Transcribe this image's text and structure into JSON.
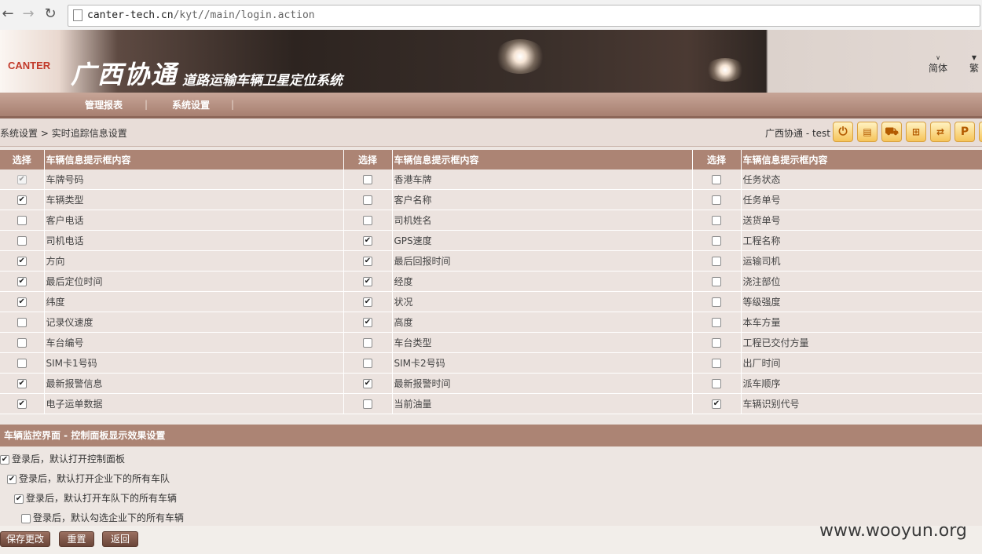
{
  "browser": {
    "url_host": "canter-tech.cn",
    "url_path": "/kyt//main/login.action"
  },
  "header": {
    "logo_text": "CANTER",
    "title": "广西协通",
    "subtitle": "道路运输车辆卫星定位系统",
    "lang_simplified": "简体",
    "lang_traditional": "繁"
  },
  "menu": {
    "items": [
      "管理报表",
      "系统设置"
    ]
  },
  "breadcrumb": {
    "root": "系统设置",
    "separator": ">",
    "current": "实时追踪信息设置"
  },
  "user": {
    "label": "广西协通 - test"
  },
  "table": {
    "col_select": "选择",
    "col_content": "车辆信息提示框内容",
    "rows": [
      [
        {
          "checked": true,
          "disabled": true,
          "label": "车牌号码"
        },
        {
          "checked": false,
          "label": "香港车牌"
        },
        {
          "checked": false,
          "label": "任务状态"
        }
      ],
      [
        {
          "checked": true,
          "label": "车辆类型"
        },
        {
          "checked": false,
          "label": "客户名称"
        },
        {
          "checked": false,
          "label": "任务单号"
        }
      ],
      [
        {
          "checked": false,
          "label": "客户电话"
        },
        {
          "checked": false,
          "label": "司机姓名"
        },
        {
          "checked": false,
          "label": "送货单号"
        }
      ],
      [
        {
          "checked": false,
          "label": "司机电话"
        },
        {
          "checked": true,
          "label": "GPS速度"
        },
        {
          "checked": false,
          "label": "工程名称"
        }
      ],
      [
        {
          "checked": true,
          "label": "方向"
        },
        {
          "checked": true,
          "label": "最后回报时间"
        },
        {
          "checked": false,
          "label": "运输司机"
        }
      ],
      [
        {
          "checked": true,
          "label": "最后定位时间"
        },
        {
          "checked": true,
          "label": "经度"
        },
        {
          "checked": false,
          "label": "浇注部位"
        }
      ],
      [
        {
          "checked": true,
          "label": "纬度"
        },
        {
          "checked": true,
          "label": "状况"
        },
        {
          "checked": false,
          "label": "等级强度"
        }
      ],
      [
        {
          "checked": false,
          "label": "记录仪速度"
        },
        {
          "checked": true,
          "label": "高度"
        },
        {
          "checked": false,
          "label": "本车方量"
        }
      ],
      [
        {
          "checked": false,
          "label": "车台编号"
        },
        {
          "checked": false,
          "label": "车台类型"
        },
        {
          "checked": false,
          "label": "工程已交付方量"
        }
      ],
      [
        {
          "checked": false,
          "label": "SIM卡1号码"
        },
        {
          "checked": false,
          "label": "SIM卡2号码"
        },
        {
          "checked": false,
          "label": "出厂时间"
        }
      ],
      [
        {
          "checked": true,
          "label": "最新报警信息"
        },
        {
          "checked": true,
          "label": "最新报警时间"
        },
        {
          "checked": false,
          "label": "派车顺序"
        }
      ],
      [
        {
          "checked": true,
          "label": "电子运单数据"
        },
        {
          "checked": false,
          "label": "当前油量"
        },
        {
          "checked": true,
          "label": "车辆识别代号"
        }
      ]
    ]
  },
  "panel": {
    "title": "车辆监控界面 - 控制面板显示效果设置",
    "options": [
      {
        "checked": true,
        "label": "登录后，默认打开控制面板"
      },
      {
        "checked": true,
        "label": "登录后，默认打开企业下的所有车队"
      },
      {
        "checked": true,
        "label": "登录后，默认打开车队下的所有车辆"
      },
      {
        "checked": false,
        "label": "登录后，默认勾选企业下的所有车辆"
      }
    ]
  },
  "buttons": {
    "save": "保存更改",
    "reset": "重置",
    "back": "返回"
  },
  "watermark": "www.wooyun.org"
}
